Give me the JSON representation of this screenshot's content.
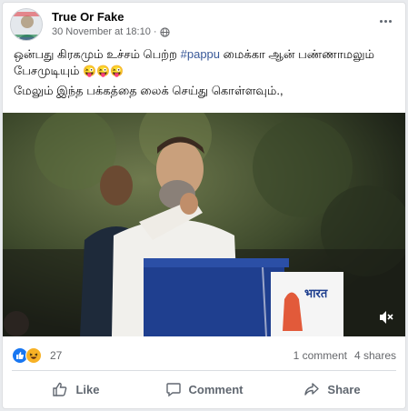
{
  "post": {
    "page_name": "True Or Fake",
    "timestamp": "30 November at 18:10",
    "privacy_icon": "globe-icon",
    "text_line1_part1": "ஒன்பது கிரகமும் உச்சம் பெற்ற ",
    "hashtag": "#pappu",
    "text_line1_part2": " மைக்கா ஆன் பண்ணாமலும் பேசமுடியும் ",
    "emojis": "😜😜😜",
    "text_line2": "மேலும் இந்த பக்கத்தை லைக் செய்து கொள்ளவும்.,"
  },
  "video": {
    "podium_text": "भारत"
  },
  "stats": {
    "reaction_count": "27",
    "comments": "1 comment",
    "shares": "4 shares"
  },
  "actions": {
    "like": "Like",
    "comment": "Comment",
    "share": "Share"
  },
  "colors": {
    "link": "#385898",
    "like_blue": "#1877f2",
    "text_secondary": "#65676b"
  }
}
